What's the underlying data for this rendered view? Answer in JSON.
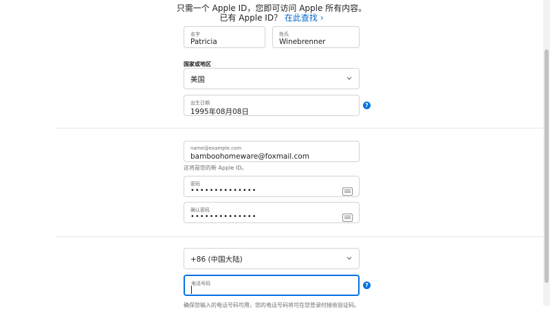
{
  "intro": {
    "line1": "只需一个 Apple ID，您即可访问 Apple 所有内容。",
    "line2_prefix": "已有 Apple ID？",
    "line2_link": "在此查找 ›"
  },
  "name": {
    "first_label": "名字",
    "first_value": "Patricia",
    "last_label": "姓氏",
    "last_value": "Winebrenner"
  },
  "region": {
    "section_title": "国家或地区",
    "selected": "美国"
  },
  "birthday": {
    "label": "出生日期",
    "value": "1995年08月08日"
  },
  "account": {
    "email_label": "name@example.com",
    "email_value": "bamboohomeware@foxmail.com",
    "email_hint": "这将是您的新 Apple ID。",
    "password_label": "密码",
    "password_value": "••••••••••••••",
    "confirm_label": "确认密码",
    "confirm_value": "••••••••••••••"
  },
  "phone": {
    "country_code": "+86 (中国大陆)",
    "number_label": "电话号码",
    "number_value": "",
    "cut_text": "确保您输入的电话号码可用，您的电话号码将可在您登录时接收验证码。"
  },
  "icons": {
    "help": "?",
    "help_icon": "question-circle-icon",
    "chevron_icon": "chevron-down-icon",
    "keyboard_icon": "keyboard-icon"
  },
  "colors": {
    "accent": "#0071e3",
    "link": "#0066cc"
  }
}
